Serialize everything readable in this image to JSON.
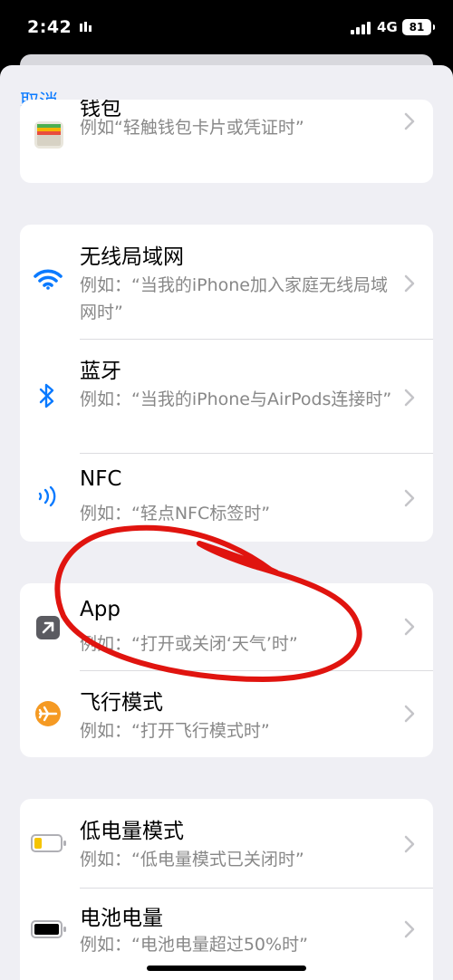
{
  "status_bar": {
    "time": "2:42",
    "network": "4G",
    "battery": "81"
  },
  "header": {
    "cancel_label": "取消"
  },
  "rows": {
    "wallet": {
      "title": "钱包",
      "subtitle": "例如“轻触钱包卡片或凭证时”"
    },
    "wifi": {
      "title": "无线局域网",
      "subtitle": "例如：“当我的iPhone加入家庭无线局域网时”"
    },
    "bluetooth": {
      "title": "蓝牙",
      "subtitle": "例如：“当我的iPhone与AirPods连接时”"
    },
    "nfc": {
      "title": "NFC",
      "subtitle": "例如：“轻点NFC标签时”"
    },
    "app": {
      "title": "App",
      "subtitle": "例如：“打开或关闭‘天气’时”"
    },
    "airplane": {
      "title": "飞行模式",
      "subtitle": "例如：“打开飞行模式时”"
    },
    "low_power": {
      "title": "低电量模式",
      "subtitle": "例如：“低电量模式已关闭时”"
    },
    "battery_level": {
      "title": "电池电量",
      "subtitle": "例如：“电池电量超过50%时”"
    }
  },
  "colors": {
    "accent": "#0a7aff",
    "annotation": "#e0140f",
    "airplane": "#f59a23",
    "app_icon": "#5b5b61"
  }
}
